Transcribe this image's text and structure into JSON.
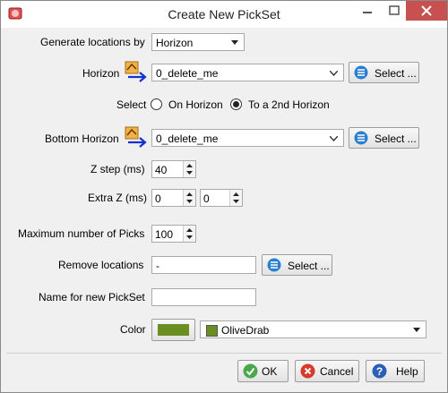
{
  "window": {
    "title": "Create New PickSet"
  },
  "colors": {
    "swatch": "#6b8e23",
    "close_button": "#c75050"
  },
  "form": {
    "generate_by": {
      "label": "Generate locations by",
      "value": "Horizon"
    },
    "horizon": {
      "label": "Horizon",
      "value": "0_delete_me",
      "select_label": "Select ..."
    },
    "select_mode": {
      "label": "Select",
      "option1": "On Horizon",
      "option2": "To a 2nd Horizon",
      "selected": "To a 2nd Horizon"
    },
    "bottom_horizon": {
      "label": "Bottom Horizon",
      "value": "0_delete_me",
      "select_label": "Select ..."
    },
    "z_step": {
      "label": "Z step (ms)",
      "value": "40"
    },
    "extra_z": {
      "label": "Extra Z (ms)",
      "value1": "0",
      "value2": "0"
    },
    "max_picks": {
      "label": "Maximum number of Picks",
      "value": "100"
    },
    "remove_locations": {
      "label": "Remove locations",
      "value": "-",
      "select_label": "Select ..."
    },
    "pickset_name": {
      "label": "Name for new PickSet",
      "value": ""
    },
    "color": {
      "label": "Color",
      "value": "OliveDrab"
    }
  },
  "buttons": {
    "ok": "OK",
    "cancel": "Cancel",
    "help": "Help"
  },
  "icons": {
    "app": "app-icon",
    "minimize": "minimize-icon",
    "maximize": "maximize-icon",
    "close": "close-icon",
    "pick_horizon": "horizon-pick-icon",
    "list": "list-icon",
    "ok": "checkmark-icon",
    "cancel": "cancel-icon",
    "help": "help-icon",
    "dropdown": "chevron-down-icon"
  }
}
